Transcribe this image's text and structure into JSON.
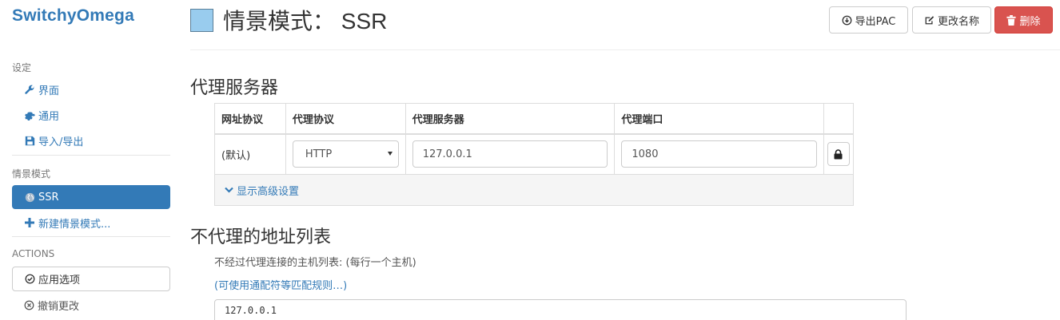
{
  "sidebar": {
    "brand": "SwitchyOmega",
    "settings_header": "设定",
    "settings_items": [
      {
        "label": "界面",
        "icon": "wrench-icon"
      },
      {
        "label": "通用",
        "icon": "gear-icon"
      },
      {
        "label": "导入/导出",
        "icon": "floppy-icon"
      }
    ],
    "profiles_header": "情景模式",
    "profiles": [
      {
        "label": "SSR",
        "icon": "globe-icon",
        "active": true
      }
    ],
    "new_profile": "新建情景模式...",
    "actions_header": "ACTIONS",
    "apply": "应用选项",
    "discard": "撤销更改"
  },
  "header": {
    "title": "情景模式： SSR",
    "color": "#99ccee",
    "export_pac": "导出PAC",
    "rename": "更改名称",
    "delete": "删除"
  },
  "proxy_servers": {
    "heading": "代理服务器",
    "columns": [
      "网址协议",
      "代理协议",
      "代理服务器",
      "代理端口"
    ],
    "rows": [
      {
        "scheme": "(默认)",
        "protocol": "HTTP",
        "server": "127.0.0.1",
        "port": "1080"
      }
    ],
    "advanced_link": "显示高级设置"
  },
  "bypass": {
    "heading": "不代理的地址列表",
    "help": "不经过代理连接的主机列表: (每行一个主机)",
    "wildcard_link": "(可使用通配符等匹配规则…)",
    "list_value": "127.0.0.1"
  }
}
